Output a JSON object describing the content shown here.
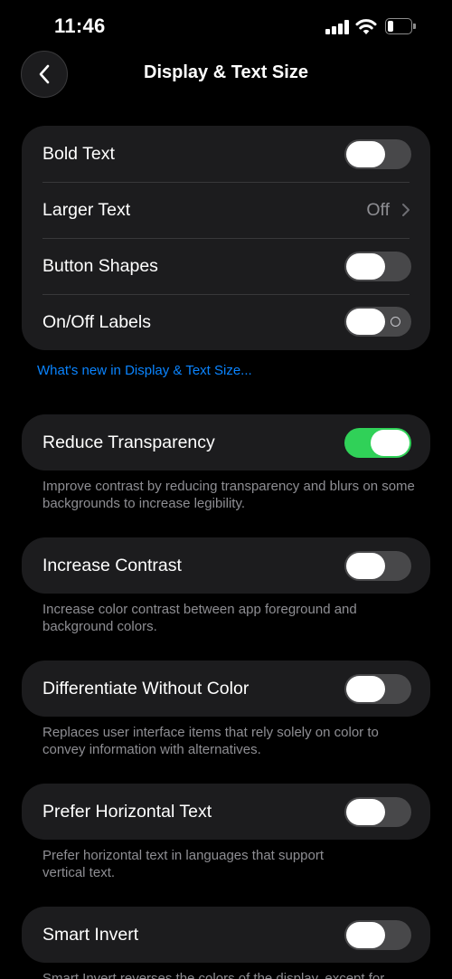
{
  "status_bar": {
    "time": "11:46"
  },
  "nav": {
    "title": "Display & Text Size"
  },
  "text_group": {
    "bold_text": {
      "label": "Bold Text",
      "on": false
    },
    "larger_text": {
      "label": "Larger Text",
      "value": "Off"
    },
    "button_shapes": {
      "label": "Button Shapes",
      "on": false
    },
    "on_off_labels": {
      "label": "On/Off Labels",
      "on": false
    }
  },
  "whats_new_link": "What's new in Display & Text Size...",
  "reduce_transparency": {
    "label": "Reduce Transparency",
    "on": true,
    "footnote": "Improve contrast by reducing transparency and blurs on some backgrounds to increase legibility."
  },
  "increase_contrast": {
    "label": "Increase Contrast",
    "on": false,
    "footnote": "Increase color contrast between app foreground and background colors."
  },
  "differentiate_without_color": {
    "label": "Differentiate Without Color",
    "on": false,
    "footnote": "Replaces user interface items that rely solely on color to convey information with alternatives."
  },
  "prefer_horizontal_text": {
    "label": "Prefer Horizontal Text",
    "on": false,
    "footnote": "Prefer horizontal text in languages that support vertical text."
  },
  "smart_invert": {
    "label": "Smart Invert",
    "on": false,
    "footnote": "Smart Invert reverses the colors of the display, except for"
  },
  "colors": {
    "toggle_on": "#30d158",
    "toggle_off": "#48484a",
    "link": "#0a84ff",
    "cell_bg": "#1c1c1e"
  }
}
